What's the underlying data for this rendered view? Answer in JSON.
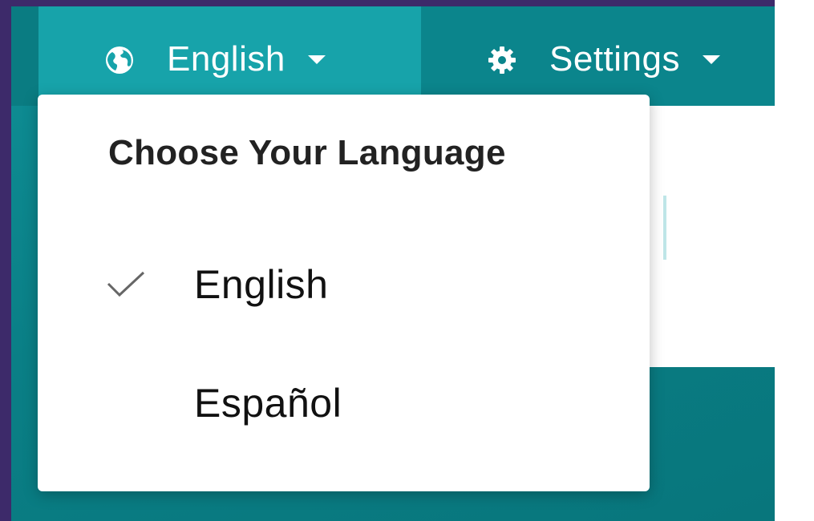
{
  "navbar": {
    "language_label": "English",
    "language_icon": "globe-icon",
    "settings_label": "Settings",
    "settings_icon": "gear-icon"
  },
  "language_menu": {
    "header": "Choose Your Language",
    "options": [
      {
        "label": "English",
        "selected": true
      },
      {
        "label": "Español",
        "selected": false
      }
    ]
  },
  "colors": {
    "teal_dark": "#0b858c",
    "teal_active": "#17a3aa",
    "frame": "#3d2a6a"
  }
}
